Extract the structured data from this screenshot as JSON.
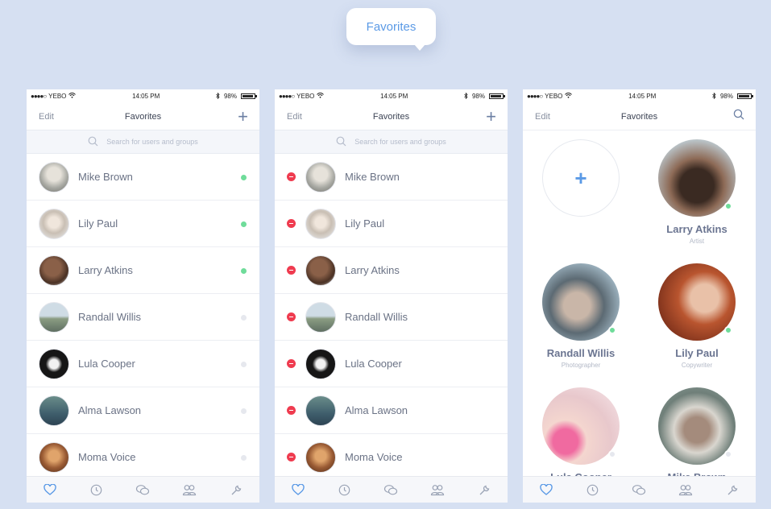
{
  "bubble_title": "Favorites",
  "status": {
    "carrier": "YEBO",
    "time": "14:05 PM",
    "battery": "98%"
  },
  "nav": {
    "edit": "Edit",
    "title": "Favorites"
  },
  "search": {
    "placeholder": "Search for users and groups"
  },
  "contacts": [
    {
      "name": "Mike Brown",
      "online": true,
      "avatar_color": "#a7a8a2"
    },
    {
      "name": "Lily Paul",
      "online": true,
      "avatar_color": "#d7d2cc"
    },
    {
      "name": "Larry Atkins",
      "online": true,
      "avatar_color": "#6b4a3a"
    },
    {
      "name": "Randall Willis",
      "online": false,
      "avatar_color": "#97a7a3"
    },
    {
      "name": "Lula Cooper",
      "online": false,
      "avatar_color": "#161616"
    },
    {
      "name": "Alma Lawson",
      "online": false,
      "avatar_color": "#4f6d77"
    },
    {
      "name": "Moma Voice",
      "online": false,
      "avatar_color": "#9a5b34"
    }
  ],
  "grid": {
    "people": [
      {
        "name": "Larry Atkins",
        "role": "Artist",
        "online": true,
        "color": "#5e4a42"
      },
      {
        "name": "Randall Willis",
        "role": "Photographer",
        "online": true,
        "color": "#7c8c96"
      },
      {
        "name": "Lily Paul",
        "role": "Copywriter",
        "online": true,
        "color": "#b9552f"
      },
      {
        "name": "Lula Cooper",
        "role": "",
        "online": false,
        "color": "#e8c8cc"
      },
      {
        "name": "Mike Brown",
        "role": "",
        "online": false,
        "color": "#8fa29c"
      }
    ]
  },
  "colors": {
    "online": "#6fdc9a",
    "offline": "#e6e8ee",
    "remove": "#ef3b4f",
    "accent": "#5b9ae6"
  }
}
